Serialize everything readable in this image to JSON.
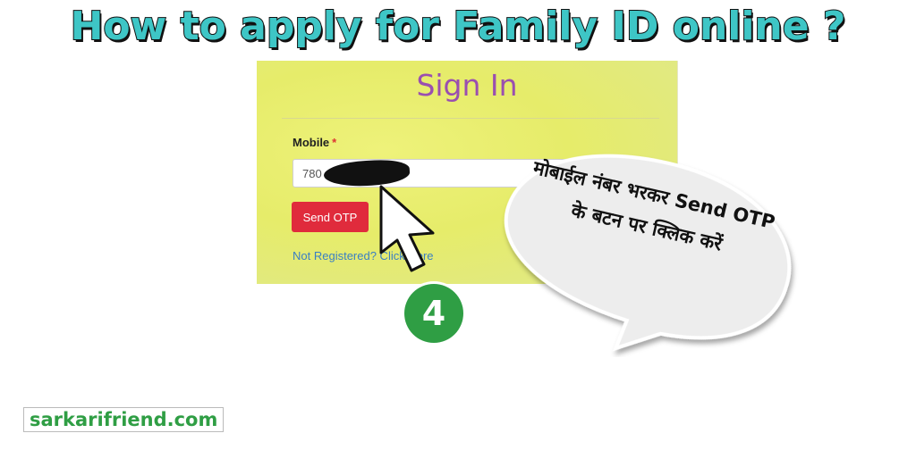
{
  "headline": "How to apply for Family ID online ?",
  "signin": {
    "title": "Sign In",
    "mobile_label": "Mobile",
    "required_mark": "*",
    "mobile_value": "780",
    "send_otp_label": "Send OTP",
    "register_link": "Not Registered? Click Here"
  },
  "step_number": "4",
  "callout_text": "मोबाईल नंबर भरकर Send OTP के बटन पर क्लिक करें",
  "watermark": "sarkarifriend.com",
  "colors": {
    "headline": "#3ec6c6",
    "title": "#9a4fb0",
    "button": "#e02b3c",
    "link": "#3a7fc4",
    "badge": "#2f9e44",
    "panel": "#e6ec6a"
  }
}
